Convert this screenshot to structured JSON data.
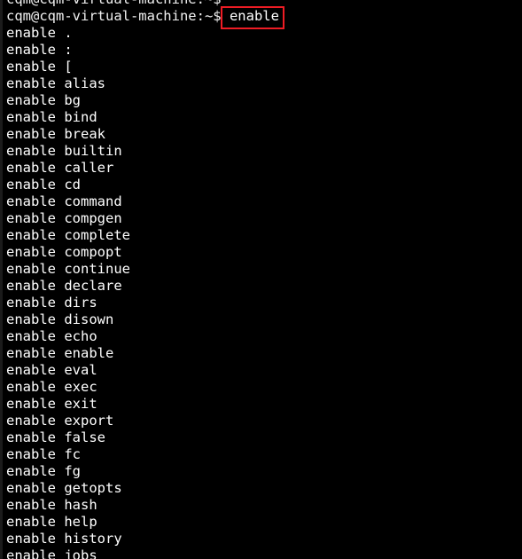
{
  "terminal": {
    "background_color": "#000000",
    "foreground_color": "#ffffff",
    "highlight_color": "#ee1c24",
    "prompt": "cqm@cqm-virtual-machine:~$",
    "scrollback_top_line": "cqm@cqm-virtual-machine:~$",
    "command_line": {
      "prompt": "cqm@cqm-virtual-machine:~$ ",
      "command": "enable"
    },
    "output_lines": [
      "enable .",
      "enable :",
      "enable [",
      "enable alias",
      "enable bg",
      "enable bind",
      "enable break",
      "enable builtin",
      "enable caller",
      "enable cd",
      "enable command",
      "enable compgen",
      "enable complete",
      "enable compopt",
      "enable continue",
      "enable declare",
      "enable dirs",
      "enable disown",
      "enable echo",
      "enable enable",
      "enable eval",
      "enable exec",
      "enable exit",
      "enable export",
      "enable false",
      "enable fc",
      "enable fg",
      "enable getopts",
      "enable hash",
      "enable help",
      "enable history",
      "enable jobs"
    ]
  }
}
